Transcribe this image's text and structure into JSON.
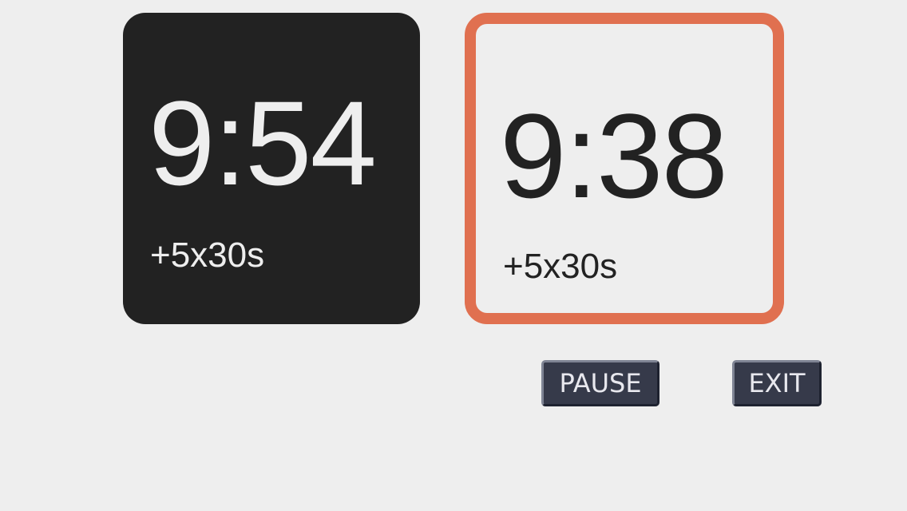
{
  "clocks": {
    "left": {
      "time": "9:54",
      "increment": "+5x30s",
      "background": "#222222",
      "text_color": "#eeeeee",
      "active": false
    },
    "right": {
      "time": "9:38",
      "increment": "+5x30s",
      "background": "#eeeeee",
      "text_color": "#222222",
      "border_color": "#e07050",
      "active": true
    }
  },
  "controls": {
    "pause_label": "PAUSE",
    "exit_label": "EXIT",
    "button_color": "#363a4a"
  },
  "page": {
    "background": "#eeeeee"
  }
}
